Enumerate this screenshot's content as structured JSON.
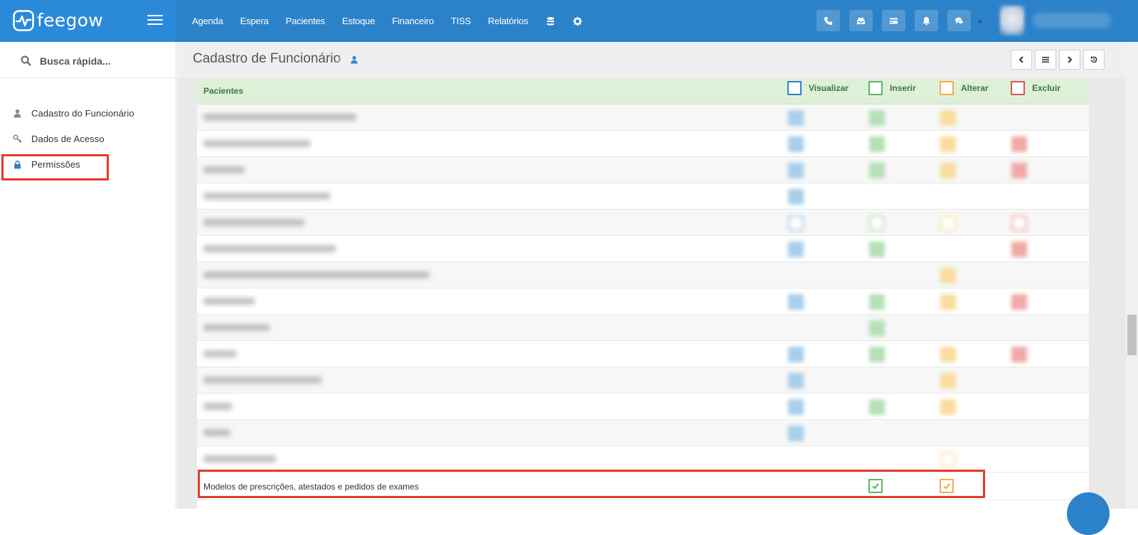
{
  "brand": {
    "name": "feegow"
  },
  "nav": {
    "items": [
      "Agenda",
      "Espera",
      "Pacientes",
      "Estoque",
      "Financeiro",
      "TISS",
      "Relatórios"
    ],
    "icons": [
      "database-icon",
      "gear-icon"
    ]
  },
  "topbar_buttons": [
    "phone-icon",
    "inbox-icon",
    "card-icon",
    "bell-icon",
    "chat-icon"
  ],
  "sidebar": {
    "search_placeholder": "Busca rápida...",
    "items": [
      {
        "label": "Cadastro do Funcionário",
        "icon": "user-icon"
      },
      {
        "label": "Dados de Acesso",
        "icon": "key-icon"
      },
      {
        "label": "Permissões",
        "icon": "lock-icon"
      }
    ]
  },
  "page": {
    "title": "Cadastro de Funcionário",
    "breadcrumb_icon": "user-icon",
    "header_buttons": [
      "chevron-left-icon",
      "list-icon",
      "chevron-right-icon",
      "history-icon"
    ]
  },
  "permissions": {
    "section_title": "Pacientes",
    "columns": [
      {
        "label": "Visualizar",
        "color": "#2c82c9"
      },
      {
        "label": "Inserir",
        "color": "#5cb85c"
      },
      {
        "label": "Alterar",
        "color": "#f0ad4e"
      },
      {
        "label": "Excluir",
        "color": "#d9534f"
      }
    ],
    "last_row": {
      "label": "Modelos de prescrições, atestados e pedidos de exames",
      "visualizar": false,
      "inserir": true,
      "alterar": true,
      "excluir": false
    }
  },
  "colors": {
    "topbar": "#2c82c9",
    "highlight": "#e5382d",
    "section_bg": "#dff0d8"
  }
}
